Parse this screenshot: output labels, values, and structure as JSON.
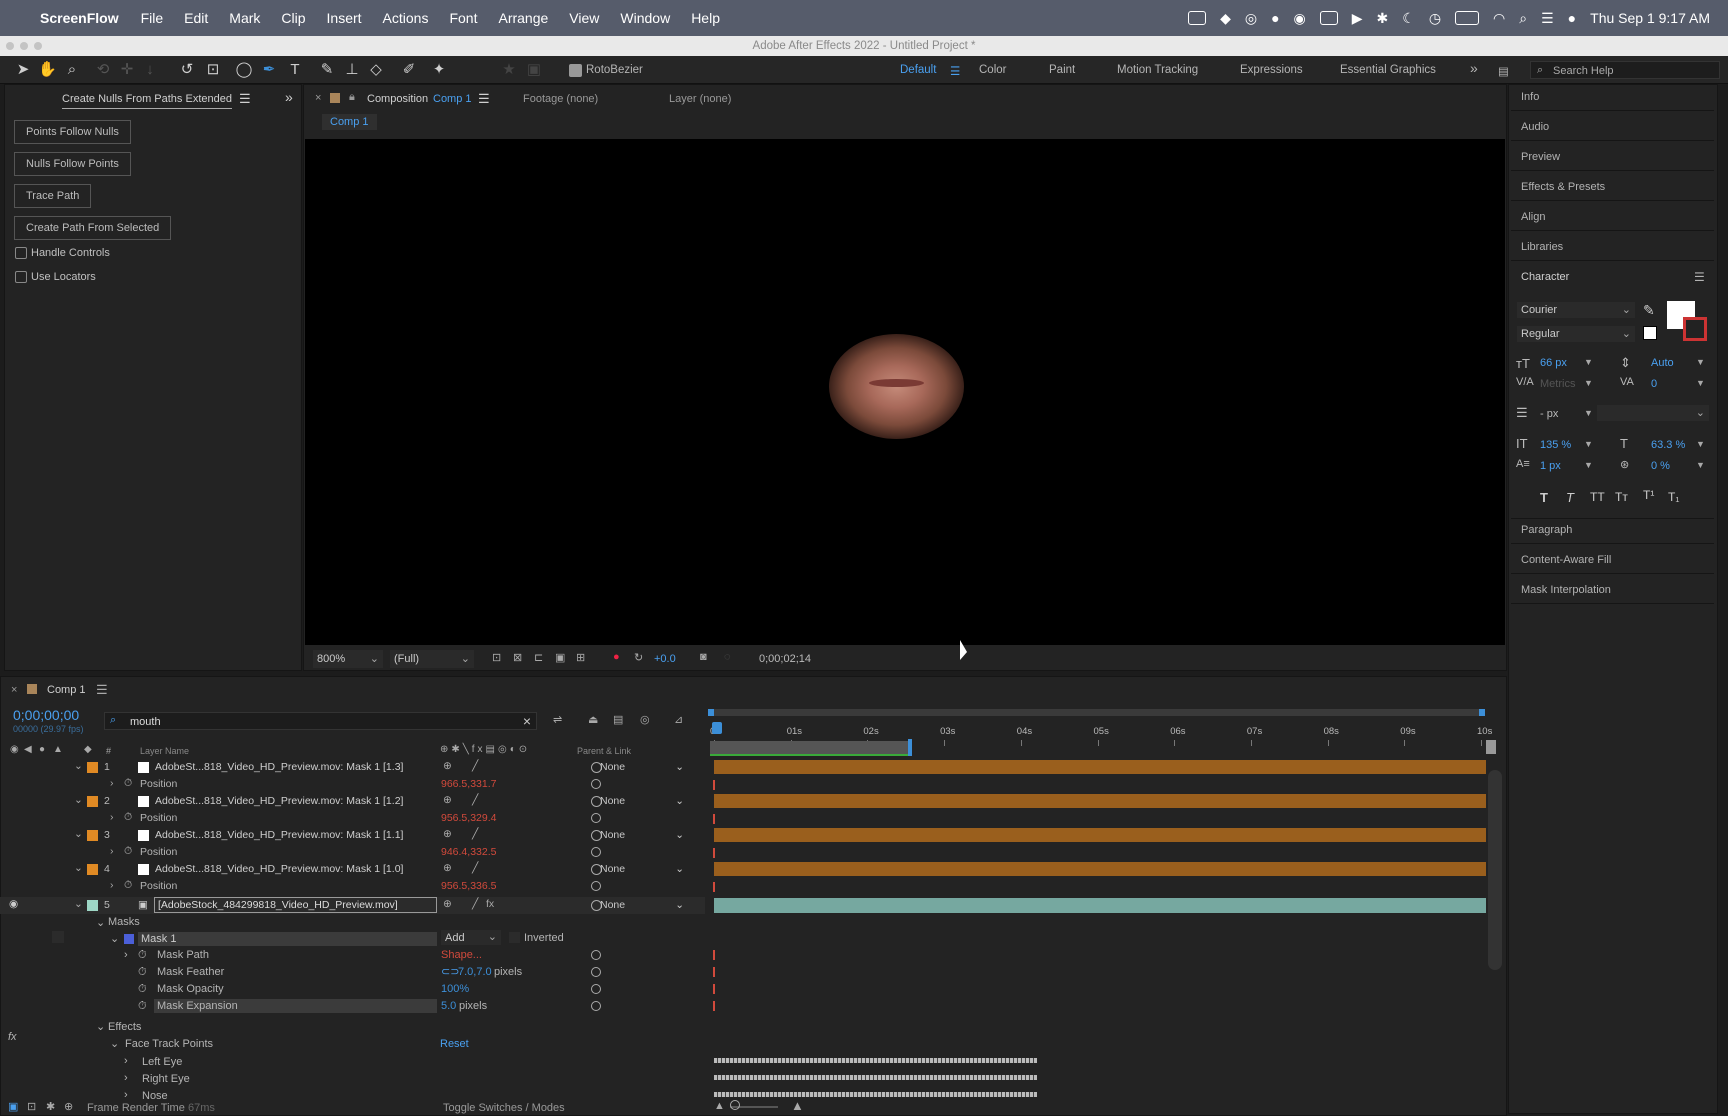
{
  "menubar": {
    "app": "ScreenFlow",
    "items": [
      "File",
      "Edit",
      "Mark",
      "Clip",
      "Insert",
      "Actions",
      "Font",
      "Arrange",
      "View",
      "Window",
      "Help"
    ],
    "clock": "Thu Sep 1  9:17 AM"
  },
  "window_title": "Adobe After Effects 2022 - Untitled Project *",
  "toolbar": {
    "rotobezier": "RotoBezier",
    "workspaces": [
      "Default",
      "Color",
      "Paint",
      "Motion Tracking",
      "Expressions",
      "Essential Graphics"
    ],
    "search_placeholder": "Search Help"
  },
  "left_panel": {
    "title": "Create Nulls From Paths Extended",
    "buttons": [
      "Points Follow Nulls",
      "Nulls Follow Points",
      "Trace Path",
      "Create Path From Selected"
    ],
    "checkboxes": [
      "Handle Controls",
      "Use Locators"
    ]
  },
  "comp_panel": {
    "tab_prefix": "Composition",
    "tab_name": "Comp 1",
    "footage": "Footage (none)",
    "layer": "Layer (none)",
    "subtab": "Comp 1",
    "zoom": "800%",
    "resolution": "(Full)",
    "exposure": "+0.0",
    "timecode": "0;00;02;14"
  },
  "right_panel": {
    "sections_top": [
      "Info",
      "Audio",
      "Preview",
      "Effects & Presets",
      "Align",
      "Libraries"
    ],
    "character": "Character",
    "font": "Courier",
    "style": "Regular",
    "size": "66 px",
    "leading": "Auto",
    "kerning": "Metrics",
    "tracking": "0",
    "stroke": "- px",
    "vscale": "135 %",
    "hscale": "63.3 %",
    "baseline": "1 px",
    "tsume": "0 %",
    "sections_bottom": [
      "Paragraph",
      "Content-Aware Fill",
      "Mask Interpolation"
    ]
  },
  "timeline": {
    "comp": "Comp 1",
    "time": "0;00;00;00",
    "fps": "00000 (29.97 fps)",
    "search": "mouth",
    "col_layer": "Layer Name",
    "col_parent": "Parent & Link",
    "ticks": [
      "0s",
      "01s",
      "02s",
      "03s",
      "04s",
      "05s",
      "06s",
      "07s",
      "08s",
      "09s",
      "10s"
    ],
    "layers": [
      {
        "num": "1",
        "name": "AdobeSt...818_Video_HD_Preview.mov: Mask 1 [1.3]",
        "parent": "None",
        "pos": "966.5,331.7"
      },
      {
        "num": "2",
        "name": "AdobeSt...818_Video_HD_Preview.mov: Mask 1 [1.2]",
        "parent": "None",
        "pos": "956.5,329.4"
      },
      {
        "num": "3",
        "name": "AdobeSt...818_Video_HD_Preview.mov: Mask 1 [1.1]",
        "parent": "None",
        "pos": "946.4,332.5"
      },
      {
        "num": "4",
        "name": "AdobeSt...818_Video_HD_Preview.mov: Mask 1 [1.0]",
        "parent": "None",
        "pos": "956.5,336.5"
      }
    ],
    "layer5": {
      "num": "5",
      "name": "[AdobeStock_484299818_Video_HD_Preview.mov]",
      "parent": "None"
    },
    "position_label": "Position",
    "masks": "Masks",
    "mask1": "Mask 1",
    "mode": "Add",
    "inverted": "Inverted",
    "mask_props": [
      {
        "name": "Mask Path",
        "value": "Shape..."
      },
      {
        "name": "Mask Feather",
        "value": "7.0,7.0",
        "unit": "pixels"
      },
      {
        "name": "Mask Opacity",
        "value": "100%"
      },
      {
        "name": "Mask Expansion",
        "value": "5.0",
        "unit": "pixels"
      }
    ],
    "effects": "Effects",
    "face_track": "Face Track Points",
    "reset": "Reset",
    "points": [
      "Left Eye",
      "Right Eye",
      "Nose"
    ],
    "footer_render": "Frame Render Time",
    "footer_ms": "67ms",
    "footer_toggle": "Toggle Switches / Modes"
  }
}
